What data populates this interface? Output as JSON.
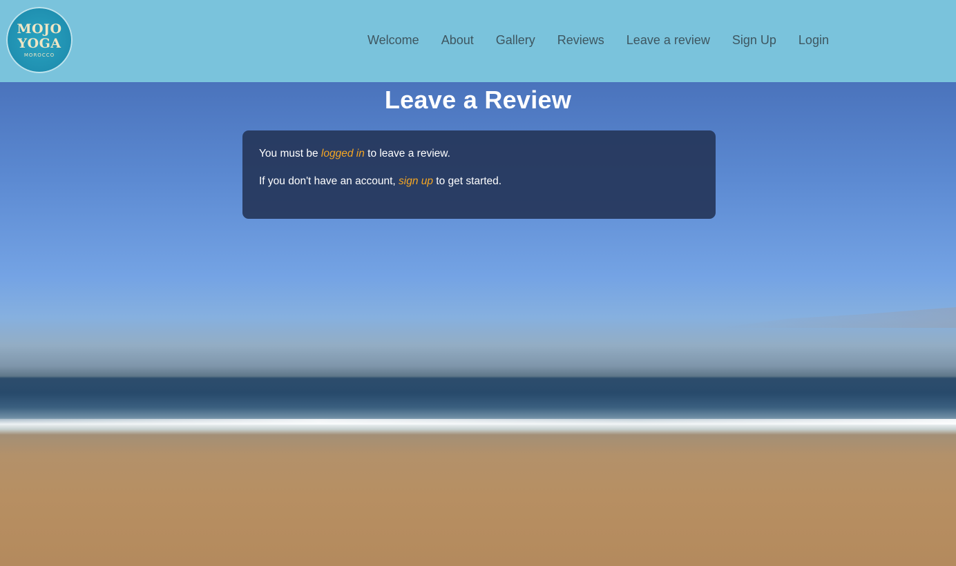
{
  "logo": {
    "line1": "MOJO",
    "line2": "YOGA",
    "line3": "MOROCCO"
  },
  "nav": {
    "items": [
      {
        "label": "Welcome"
      },
      {
        "label": "About"
      },
      {
        "label": "Gallery"
      },
      {
        "label": "Reviews"
      },
      {
        "label": "Leave a review"
      },
      {
        "label": "Sign Up"
      },
      {
        "label": "Login"
      }
    ]
  },
  "page": {
    "title": "Leave a Review"
  },
  "notice": {
    "line1_prefix": "You must be ",
    "line1_link": "logged in",
    "line1_suffix": " to leave a review.",
    "line2_prefix": "If you don't have an account, ",
    "line2_link": "sign up",
    "line2_suffix": " to get started."
  },
  "colors": {
    "header_bg": "#7ac3dc",
    "card_bg": "#25365a",
    "link": "#f5a623",
    "nav_text": "#3e5660"
  }
}
